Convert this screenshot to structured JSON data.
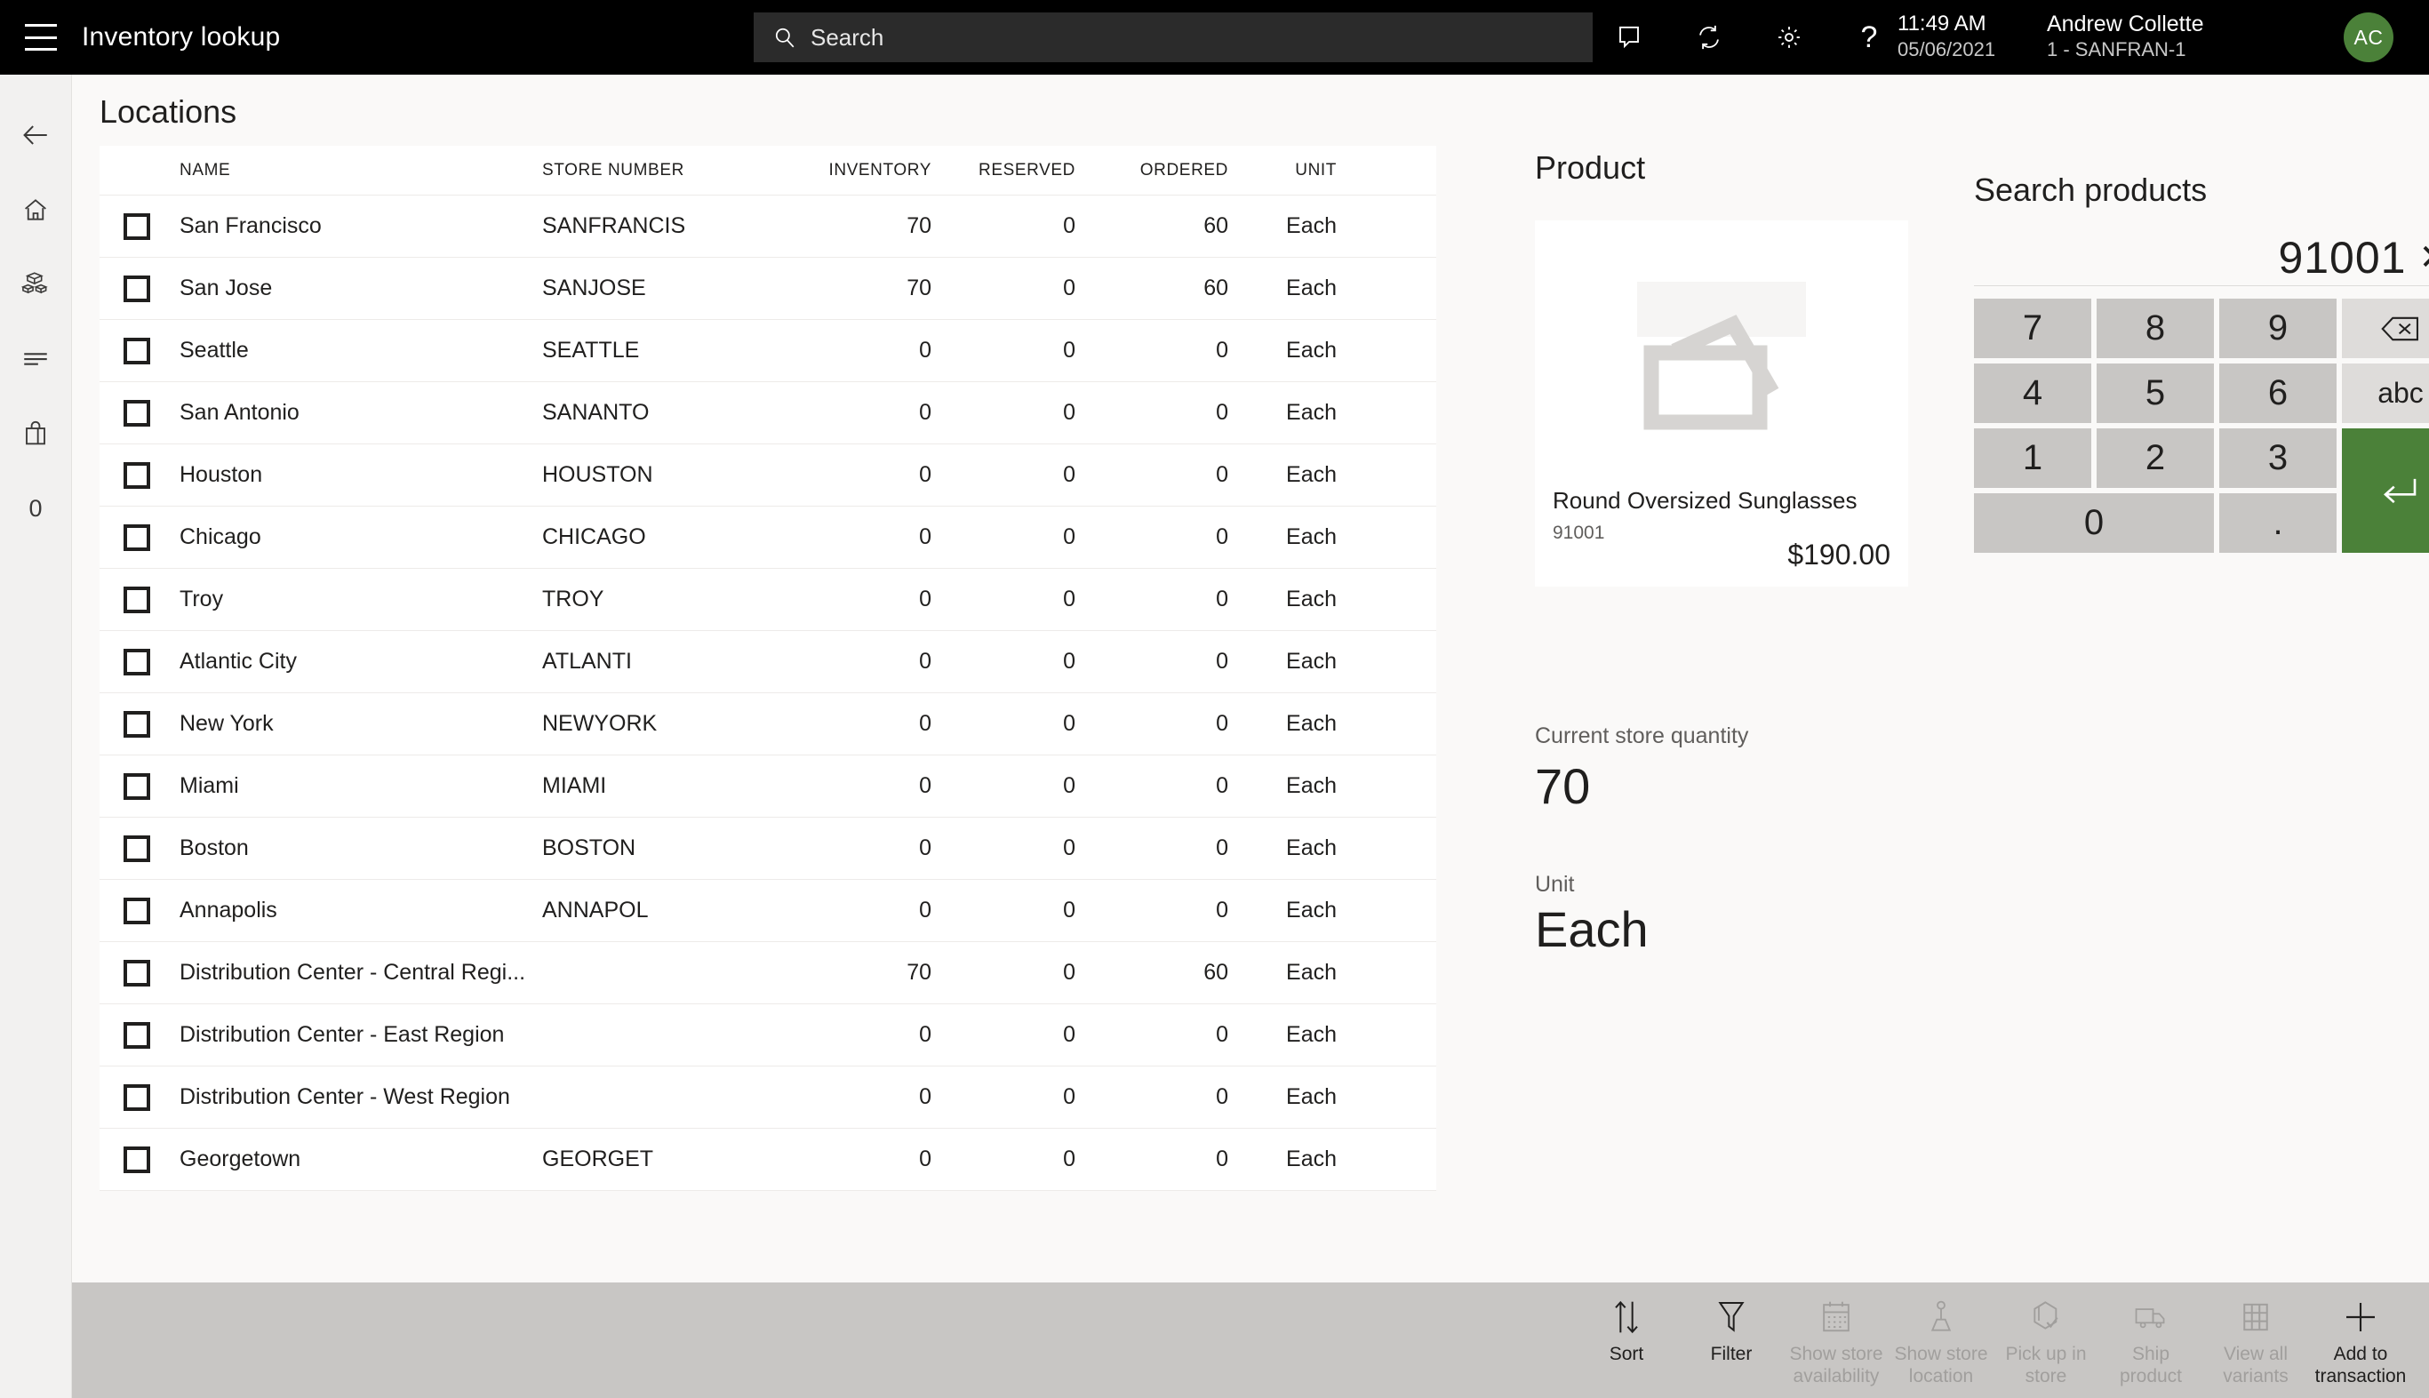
{
  "header": {
    "menu_icon": "hamburger-icon",
    "title": "Inventory lookup",
    "search_placeholder": "Search",
    "icons": [
      "note-icon",
      "sync-icon",
      "gear-icon",
      "help-icon"
    ],
    "help_glyph": "?",
    "time": "11:49 AM",
    "date": "05/06/2021",
    "user_name": "Andrew Collette",
    "user_store": "1 - SANFRAN-1",
    "avatar_initials": "AC",
    "avatar_color": "#4B8139"
  },
  "rail": {
    "items": [
      {
        "name": "back-arrow-icon",
        "label": ""
      },
      {
        "name": "home-icon",
        "label": ""
      },
      {
        "name": "products-icon",
        "label": ""
      },
      {
        "name": "list-icon",
        "label": ""
      },
      {
        "name": "shopping-bag-icon",
        "label": ""
      },
      {
        "name": "cart-count",
        "label": "0"
      }
    ],
    "cart_count": "0"
  },
  "locations": {
    "title": "Locations",
    "columns": [
      "NAME",
      "STORE NUMBER",
      "INVENTORY",
      "RESERVED",
      "ORDERED",
      "UNIT"
    ],
    "rows": [
      {
        "name": "San Francisco",
        "store": "SANFRANCIS",
        "inventory": "70",
        "reserved": "0",
        "ordered": "60",
        "unit": "Each"
      },
      {
        "name": "San Jose",
        "store": "SANJOSE",
        "inventory": "70",
        "reserved": "0",
        "ordered": "60",
        "unit": "Each"
      },
      {
        "name": "Seattle",
        "store": "SEATTLE",
        "inventory": "0",
        "reserved": "0",
        "ordered": "0",
        "unit": "Each"
      },
      {
        "name": "San Antonio",
        "store": "SANANTO",
        "inventory": "0",
        "reserved": "0",
        "ordered": "0",
        "unit": "Each"
      },
      {
        "name": "Houston",
        "store": "HOUSTON",
        "inventory": "0",
        "reserved": "0",
        "ordered": "0",
        "unit": "Each"
      },
      {
        "name": "Chicago",
        "store": "CHICAGO",
        "inventory": "0",
        "reserved": "0",
        "ordered": "0",
        "unit": "Each"
      },
      {
        "name": "Troy",
        "store": "TROY",
        "inventory": "0",
        "reserved": "0",
        "ordered": "0",
        "unit": "Each"
      },
      {
        "name": "Atlantic City",
        "store": "ATLANTI",
        "inventory": "0",
        "reserved": "0",
        "ordered": "0",
        "unit": "Each"
      },
      {
        "name": "New York",
        "store": "NEWYORK",
        "inventory": "0",
        "reserved": "0",
        "ordered": "0",
        "unit": "Each"
      },
      {
        "name": "Miami",
        "store": "MIAMI",
        "inventory": "0",
        "reserved": "0",
        "ordered": "0",
        "unit": "Each"
      },
      {
        "name": "Boston",
        "store": "BOSTON",
        "inventory": "0",
        "reserved": "0",
        "ordered": "0",
        "unit": "Each"
      },
      {
        "name": "Annapolis",
        "store": "ANNAPOL",
        "inventory": "0",
        "reserved": "0",
        "ordered": "0",
        "unit": "Each"
      },
      {
        "name": "Distribution Center - Central Regi...",
        "store": "",
        "inventory": "70",
        "reserved": "0",
        "ordered": "60",
        "unit": "Each"
      },
      {
        "name": "Distribution Center - East Region",
        "store": "",
        "inventory": "0",
        "reserved": "0",
        "ordered": "0",
        "unit": "Each"
      },
      {
        "name": "Distribution Center - West Region",
        "store": "",
        "inventory": "0",
        "reserved": "0",
        "ordered": "0",
        "unit": "Each"
      },
      {
        "name": "Georgetown",
        "store": "GEORGET",
        "inventory": "0",
        "reserved": "0",
        "ordered": "0",
        "unit": "Each"
      }
    ]
  },
  "product": {
    "title": "Product",
    "image_placeholder": "image-placeholder-icon",
    "name": "Round Oversized Sunglasses",
    "id": "91001",
    "price": "$190.00",
    "qty_label": "Current store quantity",
    "qty_value": "70",
    "unit_label": "Unit",
    "unit_value": "Each"
  },
  "keypad": {
    "title": "Search products",
    "display_value": "91001",
    "clear_glyph": "✕",
    "keys": [
      {
        "label": "7",
        "type": "digit"
      },
      {
        "label": "8",
        "type": "digit"
      },
      {
        "label": "9",
        "type": "digit"
      },
      {
        "label": "",
        "type": "backspace"
      },
      {
        "label": "4",
        "type": "digit"
      },
      {
        "label": "5",
        "type": "digit"
      },
      {
        "label": "6",
        "type": "digit"
      },
      {
        "label": "abc",
        "type": "alpha"
      },
      {
        "label": "1",
        "type": "digit"
      },
      {
        "label": "2",
        "type": "digit"
      },
      {
        "label": "3",
        "type": "digit"
      },
      {
        "label": "0",
        "type": "digit"
      },
      {
        "label": ".",
        "type": "digit"
      }
    ],
    "backspace_label": "backspace-icon",
    "alpha_label": "abc",
    "enter_label": "enter-icon",
    "enter_color": "#4B8139"
  },
  "toolbar": {
    "items": [
      {
        "label1": "Sort",
        "label2": "",
        "icon": "sort-icon",
        "disabled": false
      },
      {
        "label1": "Filter",
        "label2": "",
        "icon": "filter-icon",
        "disabled": false
      },
      {
        "label1": "Show store",
        "label2": "availability",
        "icon": "calendar-icon",
        "disabled": true
      },
      {
        "label1": "Show store",
        "label2": "location",
        "icon": "map-pin-icon",
        "disabled": true
      },
      {
        "label1": "Pick up in",
        "label2": "store",
        "icon": "package-check-icon",
        "disabled": true
      },
      {
        "label1": "Ship",
        "label2": "product",
        "icon": "truck-icon",
        "disabled": true
      },
      {
        "label1": "View all",
        "label2": "variants",
        "icon": "grid-icon",
        "disabled": true
      },
      {
        "label1": "Add to",
        "label2": "transaction",
        "icon": "plus-icon",
        "disabled": false
      }
    ]
  }
}
